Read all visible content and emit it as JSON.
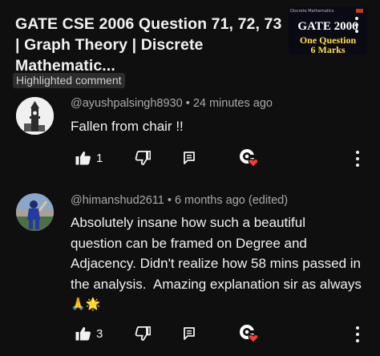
{
  "video": {
    "title": "GATE CSE 2006 Question 71, 72, 73 | Graph Theory | Discrete Mathematic...",
    "thumbnail": {
      "top_text": "Discrete Mathematics",
      "title": "GATE 2006",
      "subtitle_line1": "One Question",
      "subtitle_line2": "6 Marks"
    }
  },
  "highlighted_label": "Highlighted comment",
  "comments": [
    {
      "author": "@ayushpalsingh8930",
      "time": "24 minutes ago",
      "meta": "@ayushpalsingh8930 • 24 minutes ago",
      "lines": [
        "Fallen from chair !!"
      ],
      "likes": "1",
      "avatar_icon": "clock-tower-avatar"
    },
    {
      "author": "@himanshud2611",
      "time": "6 months ago (edited)",
      "meta": "@himanshud2611 • 6 months ago (edited)",
      "lines": [
        "Absolutely insane how such a beautiful",
        "question can be framed on Degree and",
        "Adjacency. Didn't realize how 58 mins passed in",
        "the analysis.  Amazing explanation sir as always"
      ],
      "emojis": "🙏🌟",
      "likes": "3",
      "avatar_icon": "cricketer-avatar"
    }
  ],
  "icons": {
    "like": "thumb-up-icon",
    "dislike": "thumb-down-icon",
    "reply": "reply-comment-icon",
    "heart": "creator-heart-icon",
    "more": "more-vert-icon"
  },
  "colors": {
    "background": "#0f0f0f",
    "heart": "#ff3b30",
    "meta_text": "#aaaaaa"
  }
}
